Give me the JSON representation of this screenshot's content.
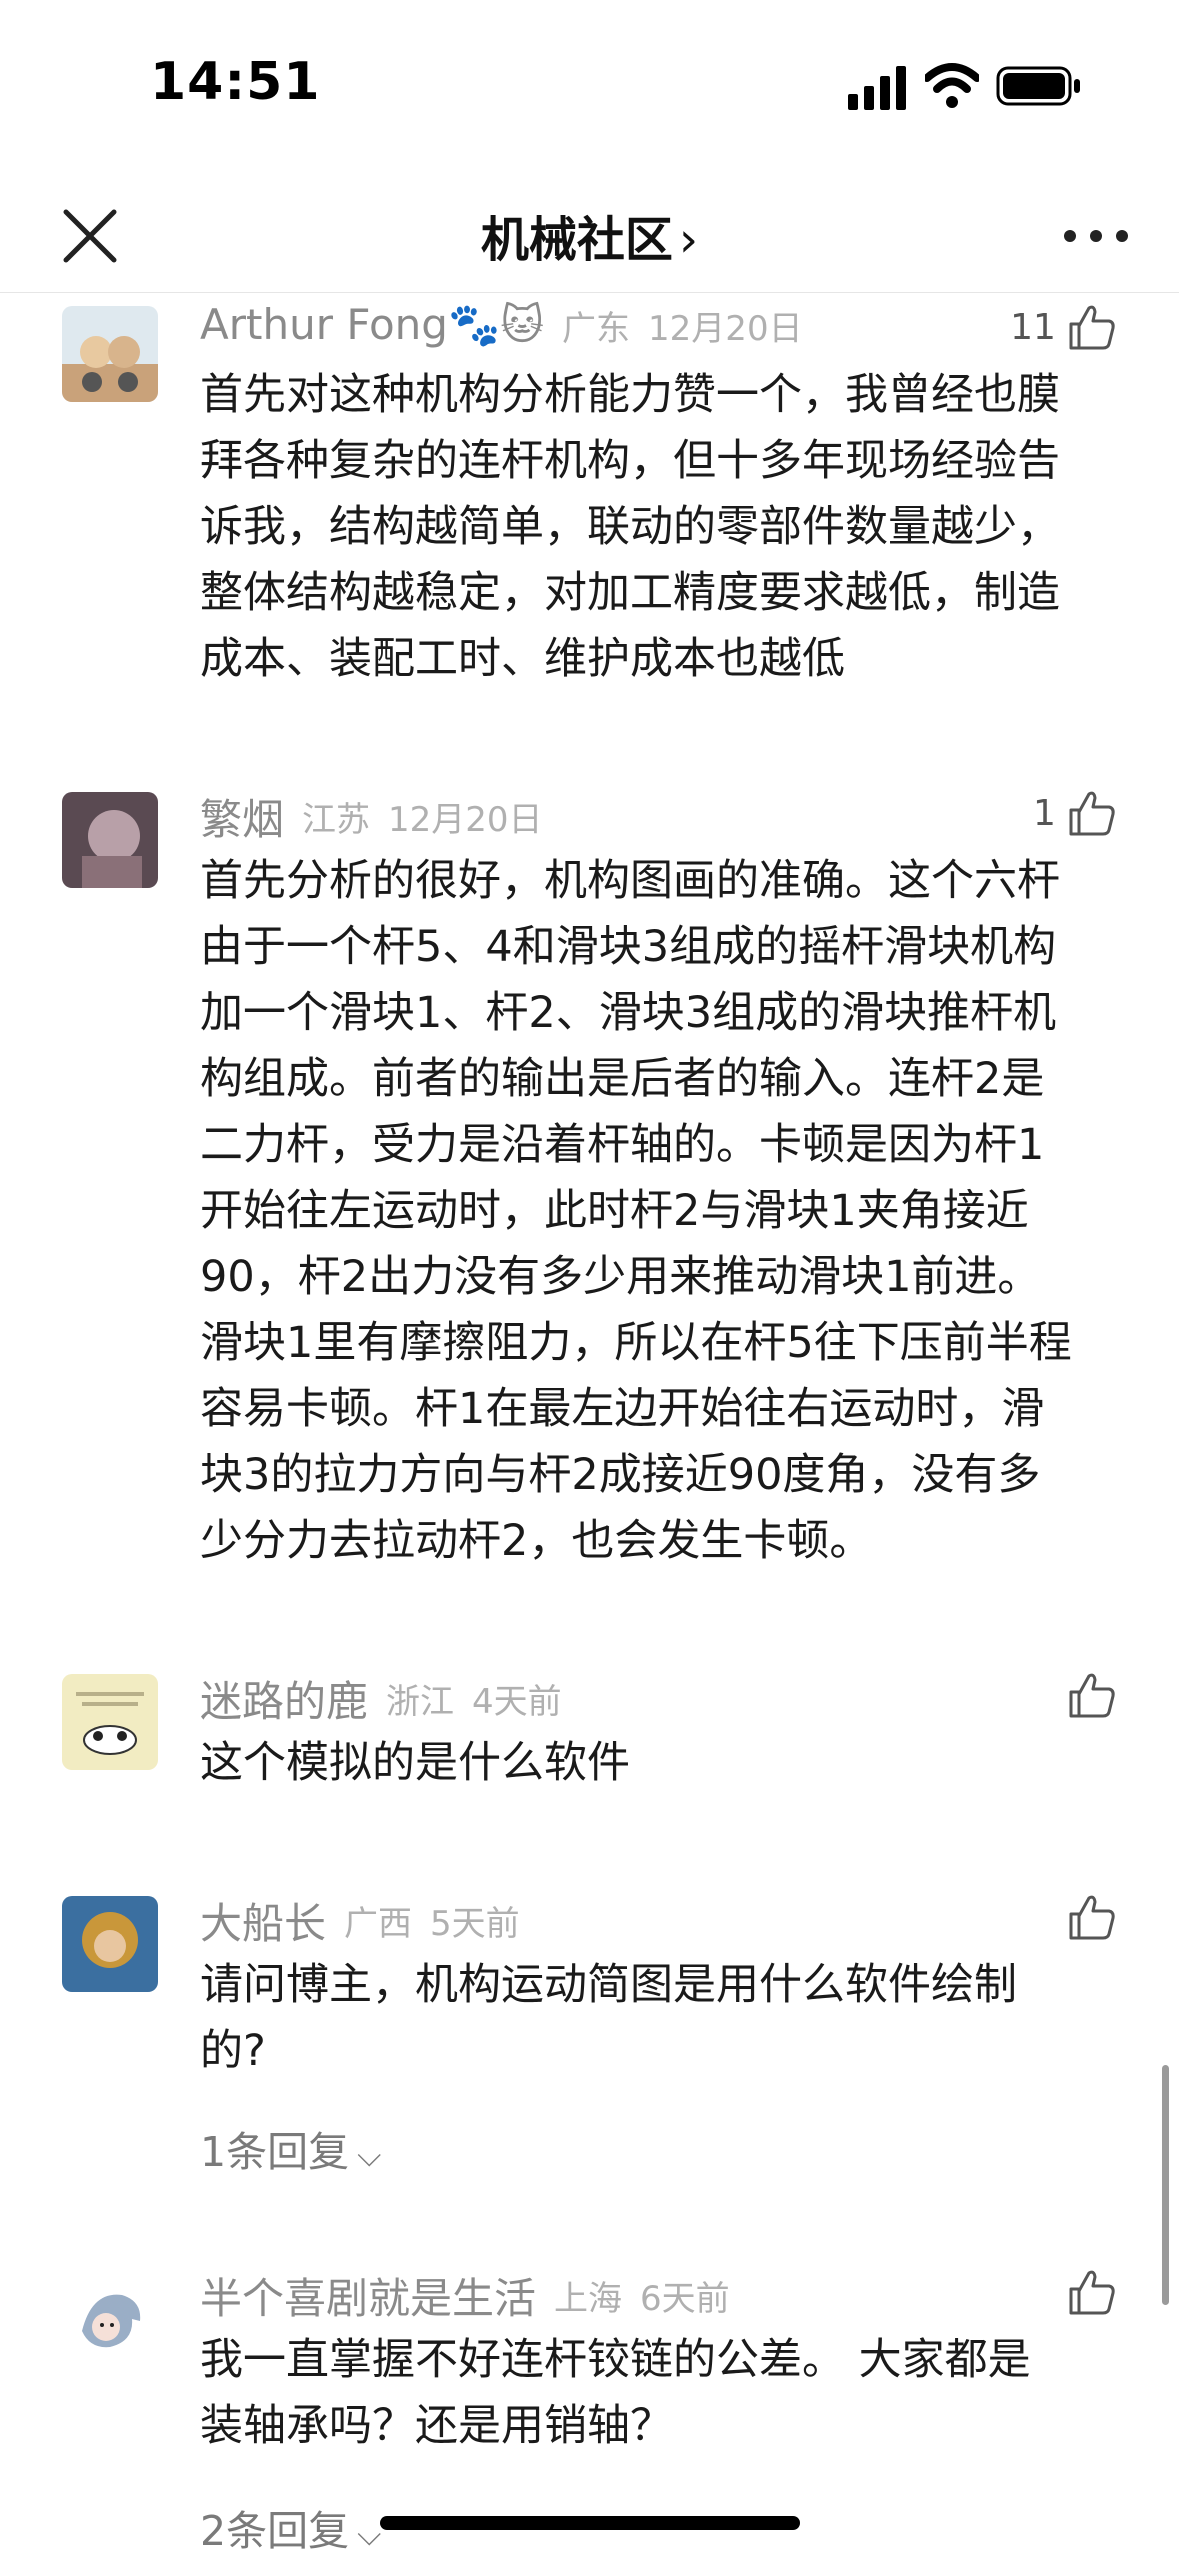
{
  "status": {
    "time": "14:51"
  },
  "nav": {
    "title": "机械社区",
    "title_chevron": "›"
  },
  "icons": {
    "close": "close-icon",
    "more": "more-icon",
    "like": "thumbs-up-icon",
    "signal": "cellular-signal-icon",
    "wifi": "wifi-icon",
    "battery": "battery-icon",
    "chevron_down": "chevron-down-icon"
  },
  "comments": [
    {
      "name": "Arthur Fong🐾🐱",
      "location": "广东",
      "date": "12月20日",
      "likes": "11",
      "lines": [
        "首先对这种机构分析能力赞一个，我曾经也膜",
        "拜各种复杂的连杆机构，但十多年现场经验告",
        "诉我，结构越简单，联动的零部件数量越少，",
        "整体结构越稳定，对加工精度要求越低，制造",
        "成本、装配工时、维护成本也越低"
      ]
    },
    {
      "name": "繁烟",
      "location": "江苏",
      "date": "12月20日",
      "likes": "1",
      "lines": [
        "首先分析的很好，机构图画的准确。这个六杆",
        "由于一个杆5、4和滑块3组成的摇杆滑块机构",
        "加一个滑块1、杆2、滑块3组成的滑块推杆机",
        "构组成。前者的输出是后者的输入。连杆2是",
        "二力杆，受力是沿着杆轴的。卡顿是因为杆1",
        "开始往左运动时，此时杆2与滑块1夹角接近",
        "90，杆2出力没有多少用来推动滑块1前进。",
        "滑块1里有摩擦阻力，所以在杆5往下压前半程",
        "容易卡顿。杆1在最左边开始往右运动时，滑",
        "块3的拉力方向与杆2成接近90度角，没有多",
        "少分力去拉动杆2，也会发生卡顿。"
      ]
    },
    {
      "name": "迷路的鹿",
      "location": "浙江",
      "date": "4天前",
      "likes": "",
      "lines": [
        "这个模拟的是什么软件"
      ]
    },
    {
      "name": "大船长",
      "location": "广西",
      "date": "5天前",
      "likes": "",
      "lines": [
        "请问博主，机构运动简图是用什么软件绘制",
        "的?"
      ],
      "replies": "1条回复"
    },
    {
      "name": "半个喜剧就是生活",
      "location": "上海",
      "date": "6天前",
      "likes": "",
      "lines": [
        "我一直掌握不好连杆铰链的公差。 大家都是",
        "装轴承吗？还是用销轴？"
      ],
      "replies": "2条回复"
    }
  ],
  "colors": {
    "name": "#8a8a8a",
    "meta": "#b0b0b0",
    "body_text": "#1a1a1a",
    "divider": "#e6e6e6"
  }
}
